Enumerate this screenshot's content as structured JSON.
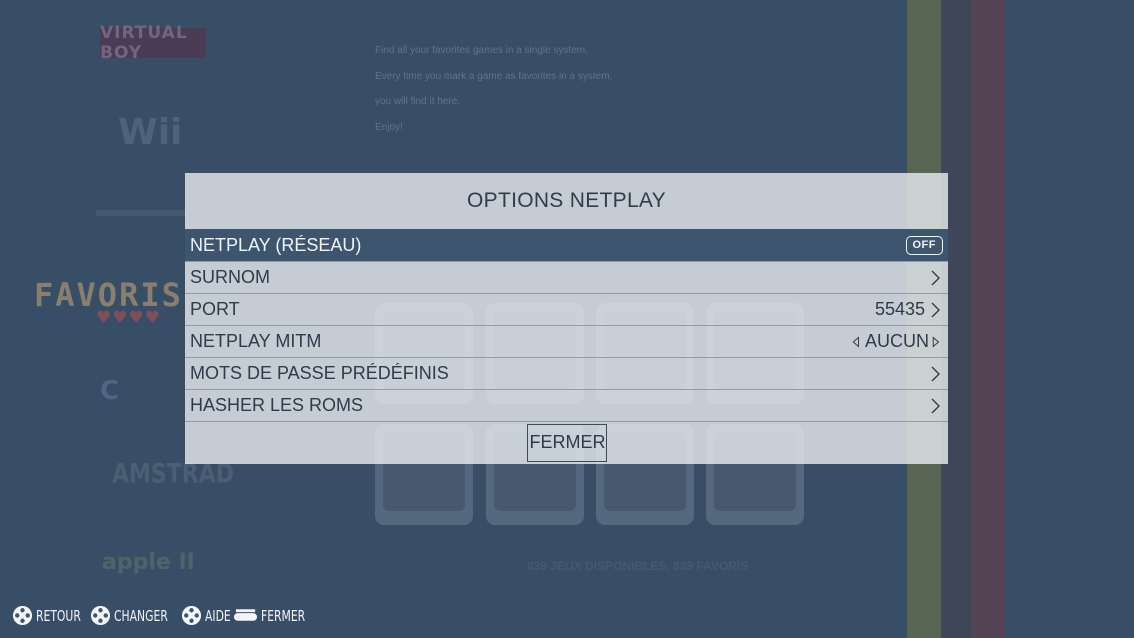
{
  "background": {
    "systems": [
      "VIRTUAL BOY",
      "Wii",
      "FAVORIS",
      "AMSTRAD",
      "apple II"
    ],
    "info_lines": [
      "Find all your favorites games in a single system.",
      "Every time you mark a game as favorites in a system,",
      "you will find it here.",
      "Enjoy!"
    ],
    "games_count": "839 JEUX DISPONIBLES, 839 FAVORIS"
  },
  "menu": {
    "title": "OPTIONS NETPLAY",
    "items": [
      {
        "label": "NETPLAY (RÉSEAU)",
        "value": "OFF",
        "selected": true
      },
      {
        "label": "SURNOM",
        "value": ""
      },
      {
        "label": "PORT",
        "value": "55435"
      },
      {
        "label": "NETPLAY MITM",
        "value": "AUCUN"
      },
      {
        "label": "MOTS DE PASSE PRÉDÉFINIS",
        "value": ""
      },
      {
        "label": "HASHER LES ROMS",
        "value": ""
      }
    ],
    "close_label": "FERMER"
  },
  "help_bar": [
    {
      "icon": "gamepad-buttons-icon",
      "label": "RETOUR"
    },
    {
      "icon": "gamepad-buttons-icon",
      "label": "CHANGER"
    },
    {
      "icon": "gamepad-buttons-icon",
      "label": "AIDE"
    },
    {
      "icon": "start-button-icon",
      "label": "FERMER"
    }
  ],
  "colors": {
    "background": "#3d5670",
    "selected_row": "#3e5570",
    "menu_bg": "#e8ecf0"
  }
}
